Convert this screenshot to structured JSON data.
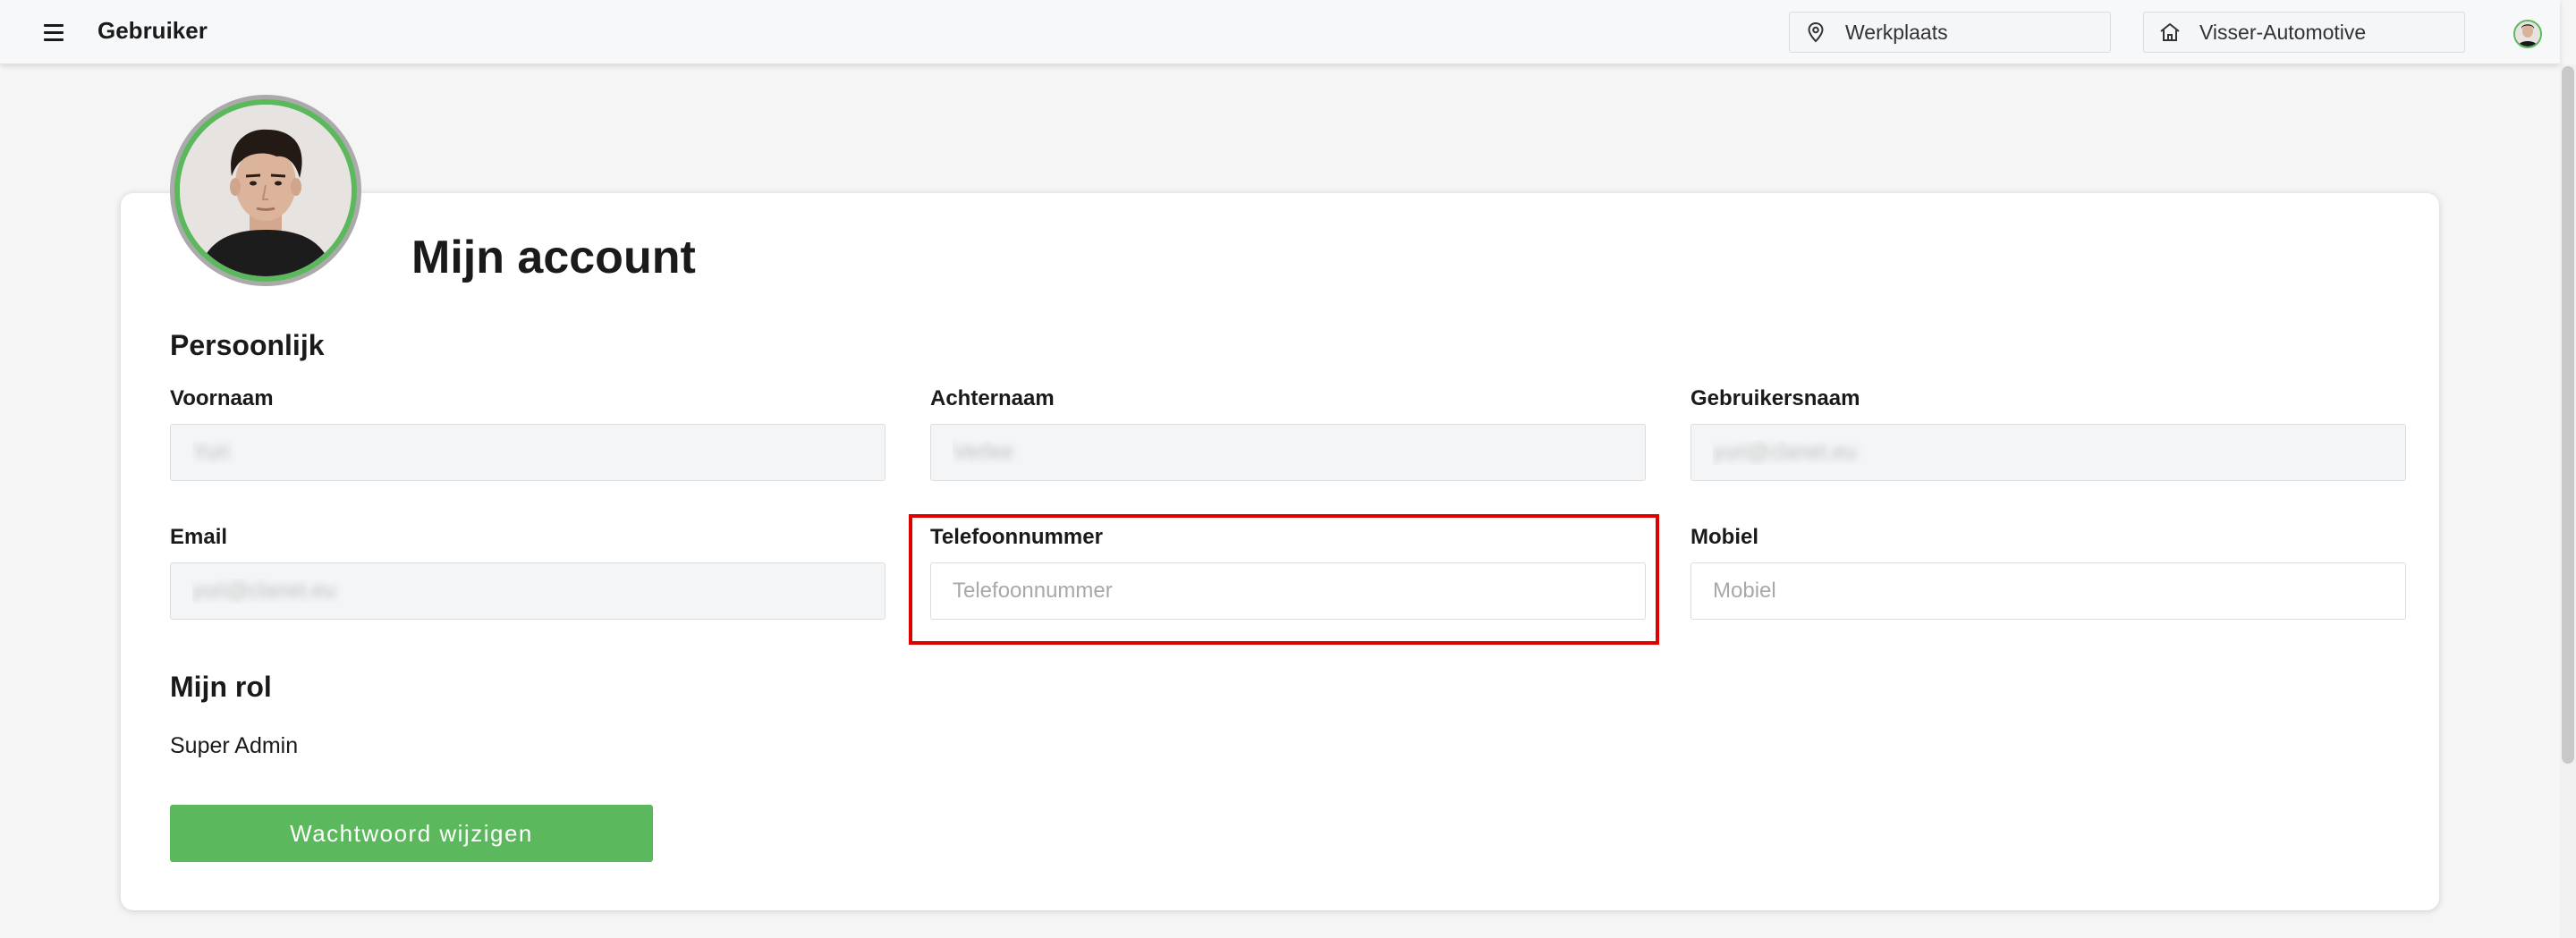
{
  "header": {
    "title": "Gebruiker",
    "location": "Werkplaats",
    "organization": "Visser-Automotive"
  },
  "page": {
    "title": "Mijn account"
  },
  "personal": {
    "section_title": "Persoonlijk",
    "first_name": {
      "label": "Voornaam",
      "value": "Yuri"
    },
    "last_name": {
      "label": "Achternaam",
      "value": "Verlee"
    },
    "username": {
      "label": "Gebruikersnaam",
      "value": "yuri@clanet.eu"
    },
    "email": {
      "label": "Email",
      "value": "yuri@clanet.eu"
    },
    "phone": {
      "label": "Telefoonnummer",
      "placeholder": "Telefoonnummer"
    },
    "mobile": {
      "label": "Mobiel",
      "placeholder": "Mobiel"
    }
  },
  "role": {
    "section_title": "Mijn rol",
    "value": "Super Admin"
  },
  "actions": {
    "change_password": "Wachtwoord wijzigen"
  },
  "colors": {
    "accent_green": "#5cb85c",
    "highlight_red": "#e00000"
  },
  "icons": {
    "menu": "hamburger-icon",
    "location": "map-pin-icon",
    "organization": "home-icon"
  }
}
